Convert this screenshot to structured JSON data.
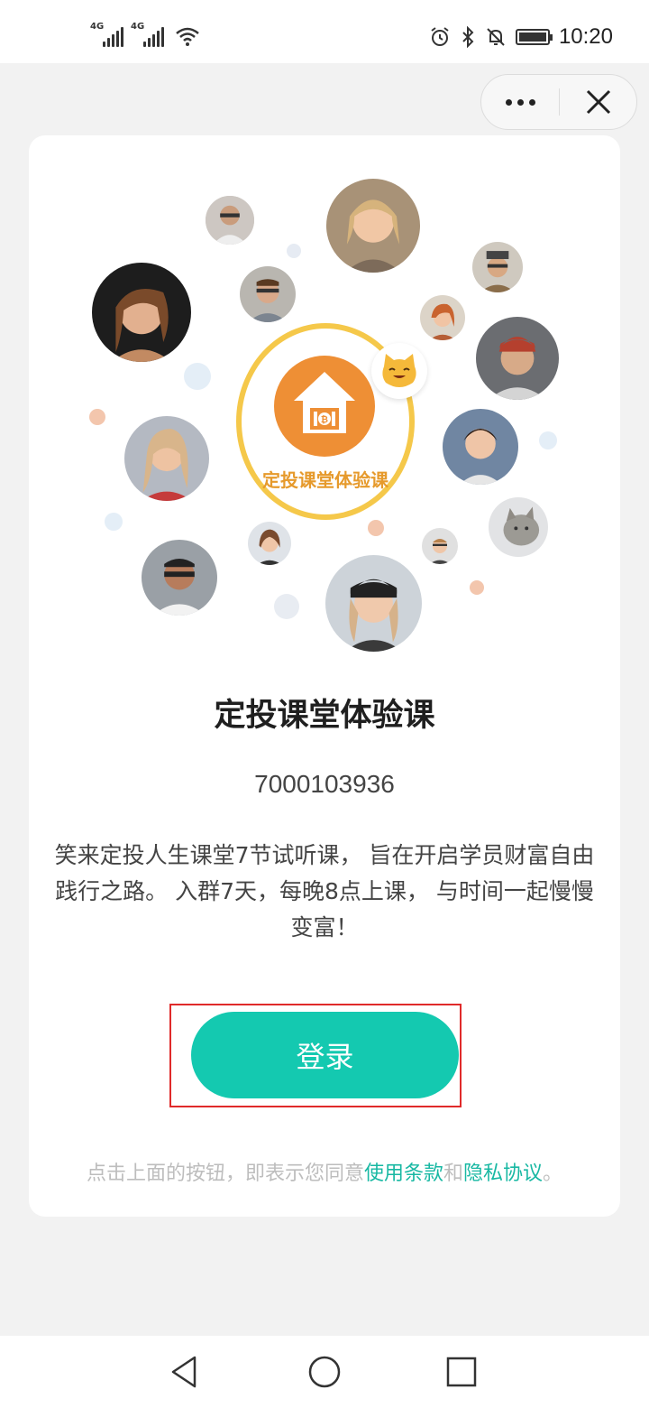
{
  "status_bar": {
    "time": "10:20",
    "signal1_label": "4G",
    "signal2_label": "4G",
    "icons": [
      "signal-icon",
      "signal-icon",
      "wifi-icon",
      "alarm-icon",
      "bluetooth-icon",
      "mute-icon",
      "battery-icon"
    ],
    "battery_level": 0.9
  },
  "capsule": {
    "more_icon": "more-dots-icon",
    "close_icon": "close-icon"
  },
  "logo": {
    "text": "定投课堂体验课",
    "badge_icon": "cat-emoji-icon",
    "badge_glyph": "😺",
    "colors": {
      "ring": "#f5c84a",
      "circle": "#ee8f35"
    }
  },
  "course": {
    "title": "定投课堂体验课",
    "id": "7000103936",
    "description": "笑来定投人生课堂7节试听课， 旨在开启学员财富自由践行之路。 入群7天，每晚8点上课， 与时间一起慢慢变富！"
  },
  "login": {
    "label": "登录",
    "color": "#14c9b0"
  },
  "agreement": {
    "prefix": "点击上面的按钮，即表示您同意",
    "terms": "使用条款",
    "and": "和",
    "privacy": "隐私协议",
    "suffix": "。"
  },
  "nav_bar": {
    "icons": [
      "back-icon",
      "home-icon",
      "recents-icon"
    ]
  }
}
